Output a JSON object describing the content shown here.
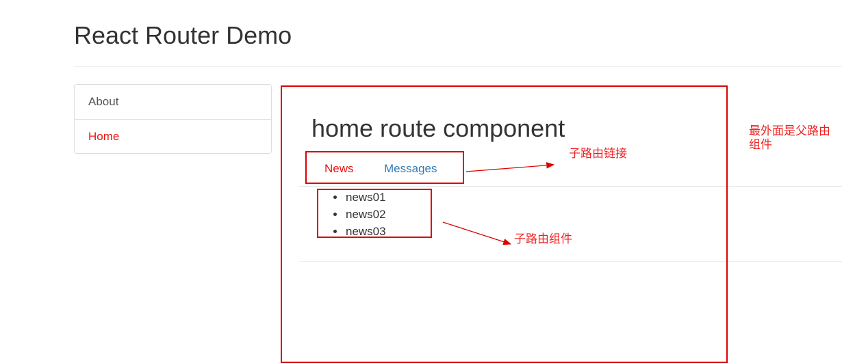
{
  "header": {
    "title": "React Router Demo"
  },
  "sidebar": {
    "items": [
      {
        "label": "About",
        "active": false
      },
      {
        "label": "Home",
        "active": true
      }
    ]
  },
  "main": {
    "title": "home route component",
    "subnav": {
      "news_label": "News",
      "messages_label": "Messages"
    },
    "news_items": [
      "news01",
      "news02",
      "news03"
    ]
  },
  "annotations": {
    "child_route_links": "子路由链接",
    "child_route_component": "子路由组件",
    "outer_parent_component": "最外面是父路由组件"
  },
  "colors": {
    "active_link": "#ee1111",
    "link": "#337ab7",
    "annotation": "#dd0000"
  }
}
